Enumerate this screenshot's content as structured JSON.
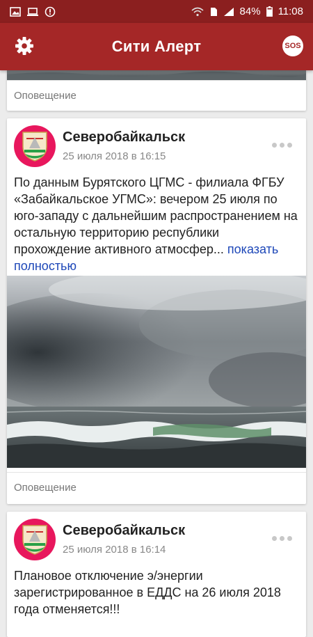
{
  "status_bar": {
    "battery": "84%",
    "time": "11:08"
  },
  "app_bar": {
    "title": "Сити Алерт",
    "sos_label": "SOS"
  },
  "posts": [
    {
      "category": "Оповещение"
    },
    {
      "author": "Северобайкальск",
      "date": "25 июля 2018 в 16:15",
      "text": "По данным Бурятского ЦГМС - филиала ФГБУ «Забайкальское УГМС»: вечером 25 июля по юго-западу с дальнейшим распространением на остальную территорию республики прохождение активного атмосфер...",
      "show_more": "показать полностью",
      "category": "Оповещение"
    },
    {
      "author": "Северобайкальск",
      "date": "25 июля 2018 в 16:14",
      "text": "Плановое отключение э/энергии зарегистрированное в ЕДДС на 26 июля 2018 года отменяется!!!"
    }
  ],
  "colors": {
    "app_bar": "#a52727",
    "status_bar": "#8b1f1f",
    "avatar_bg": "#e8175d",
    "link": "#1d47b8"
  }
}
